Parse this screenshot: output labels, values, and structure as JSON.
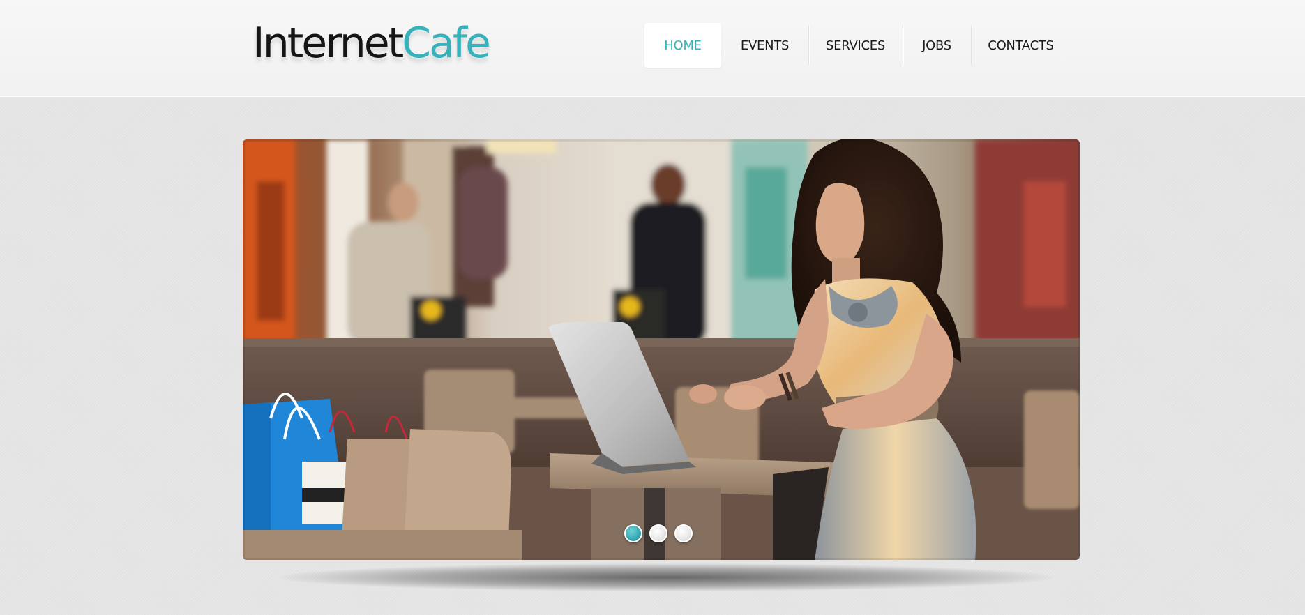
{
  "site": {
    "logo_part1": "Internet",
    "logo_part2": "Cafe"
  },
  "nav": {
    "items": [
      {
        "label": "HOME",
        "active": true
      },
      {
        "label": "EVENTS",
        "active": false
      },
      {
        "label": "SERVICES",
        "active": false
      },
      {
        "label": "JOBS",
        "active": false
      },
      {
        "label": "CONTACTS",
        "active": false
      }
    ]
  },
  "slider": {
    "image": "woman-with-laptop-in-mall-cafe",
    "slide_count": 3,
    "active_slide": 1
  },
  "colors": {
    "accent": "#35b2bb",
    "text": "#1a1a1a",
    "background": "#e6e6e6"
  }
}
